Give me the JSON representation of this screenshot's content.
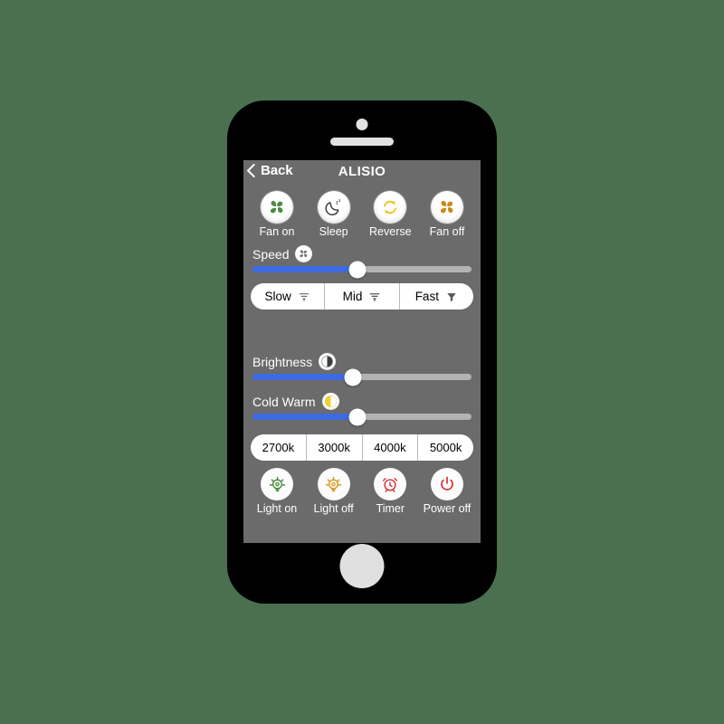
{
  "background_color": "#4a7050",
  "device": {
    "frame_color": "#000000",
    "screen_bg": "#6b6b6b",
    "camera": "camera-dot",
    "speaker": "speaker-grille",
    "home_button": "home-button"
  },
  "nav": {
    "back_label": "Back",
    "back_icon": "chevron-left-icon",
    "title": "ALISIO"
  },
  "fan_controls": [
    {
      "label": "Fan on",
      "icon": "fan-blades-icon",
      "color": "#4a8b3f"
    },
    {
      "label": "Sleep",
      "icon": "moon-zzz-icon",
      "color": "#3d3d3d"
    },
    {
      "label": "Reverse",
      "icon": "circular-arrows-icon",
      "color": "#e8c51a"
    },
    {
      "label": "Fan off",
      "icon": "fan-blades-icon",
      "color": "#c8891a"
    }
  ],
  "speed": {
    "label": "Speed",
    "badge_icon": "fan-badge-icon",
    "slider_percent": 48,
    "fill_color": "#3b6ae1",
    "track_color": "#b3b3b3"
  },
  "speed_presets": [
    {
      "label": "Slow",
      "icon": "fan-speed-low-icon"
    },
    {
      "label": "Mid",
      "icon": "fan-speed-mid-icon"
    },
    {
      "label": "Fast",
      "icon": "fan-speed-high-icon"
    }
  ],
  "brightness": {
    "label": "Brightness",
    "badge_icon": "half-circle-icon",
    "slider_percent": 46,
    "fill_color": "#3b6ae1"
  },
  "cold_warm": {
    "label": "Cold Warm",
    "badge_icon": "half-circle-yellow-icon",
    "badge_color": "#f4d232",
    "slider_percent": 48,
    "fill_color": "#3b6ae1"
  },
  "color_temperatures": [
    {
      "label": "2700k"
    },
    {
      "label": "3000k"
    },
    {
      "label": "4000k"
    },
    {
      "label": "5000k"
    }
  ],
  "light_controls": [
    {
      "label": "Light on",
      "icon": "bulb-on-icon",
      "color": "#4a8b3f"
    },
    {
      "label": "Light off",
      "icon": "bulb-off-icon",
      "color": "#d79a22"
    },
    {
      "label": "Timer",
      "icon": "alarm-clock-icon",
      "color": "#d8373c"
    },
    {
      "label": "Power off",
      "icon": "power-icon",
      "color": "#d8373c"
    }
  ]
}
